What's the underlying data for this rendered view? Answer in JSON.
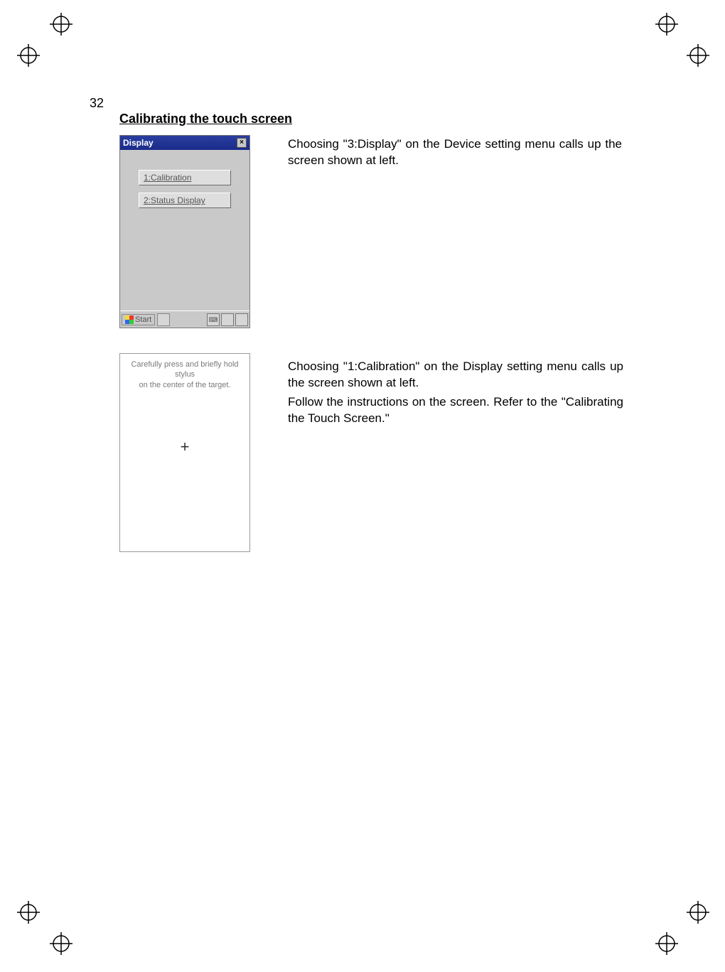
{
  "page_number": "32",
  "heading": "Calibrating the touch screen",
  "screen1": {
    "title": "Display",
    "close": "×",
    "button1": "1:Calibration",
    "button2": "2:Status Display",
    "start": "Start",
    "tray_kb": "⌨"
  },
  "para1": "Choosing \"3:Display\" on the Device setting menu calls up the screen shown at left.",
  "screen2": {
    "line1": "Carefully press and briefly hold stylus",
    "line2": "on the center of the target.",
    "cross": "+"
  },
  "para2": "Choosing \"1:Calibration\" on the Display setting menu calls up the screen shown at left.",
  "para3": "Follow the instructions on the screen. Refer to the \"Calibrating the Touch Screen.\""
}
